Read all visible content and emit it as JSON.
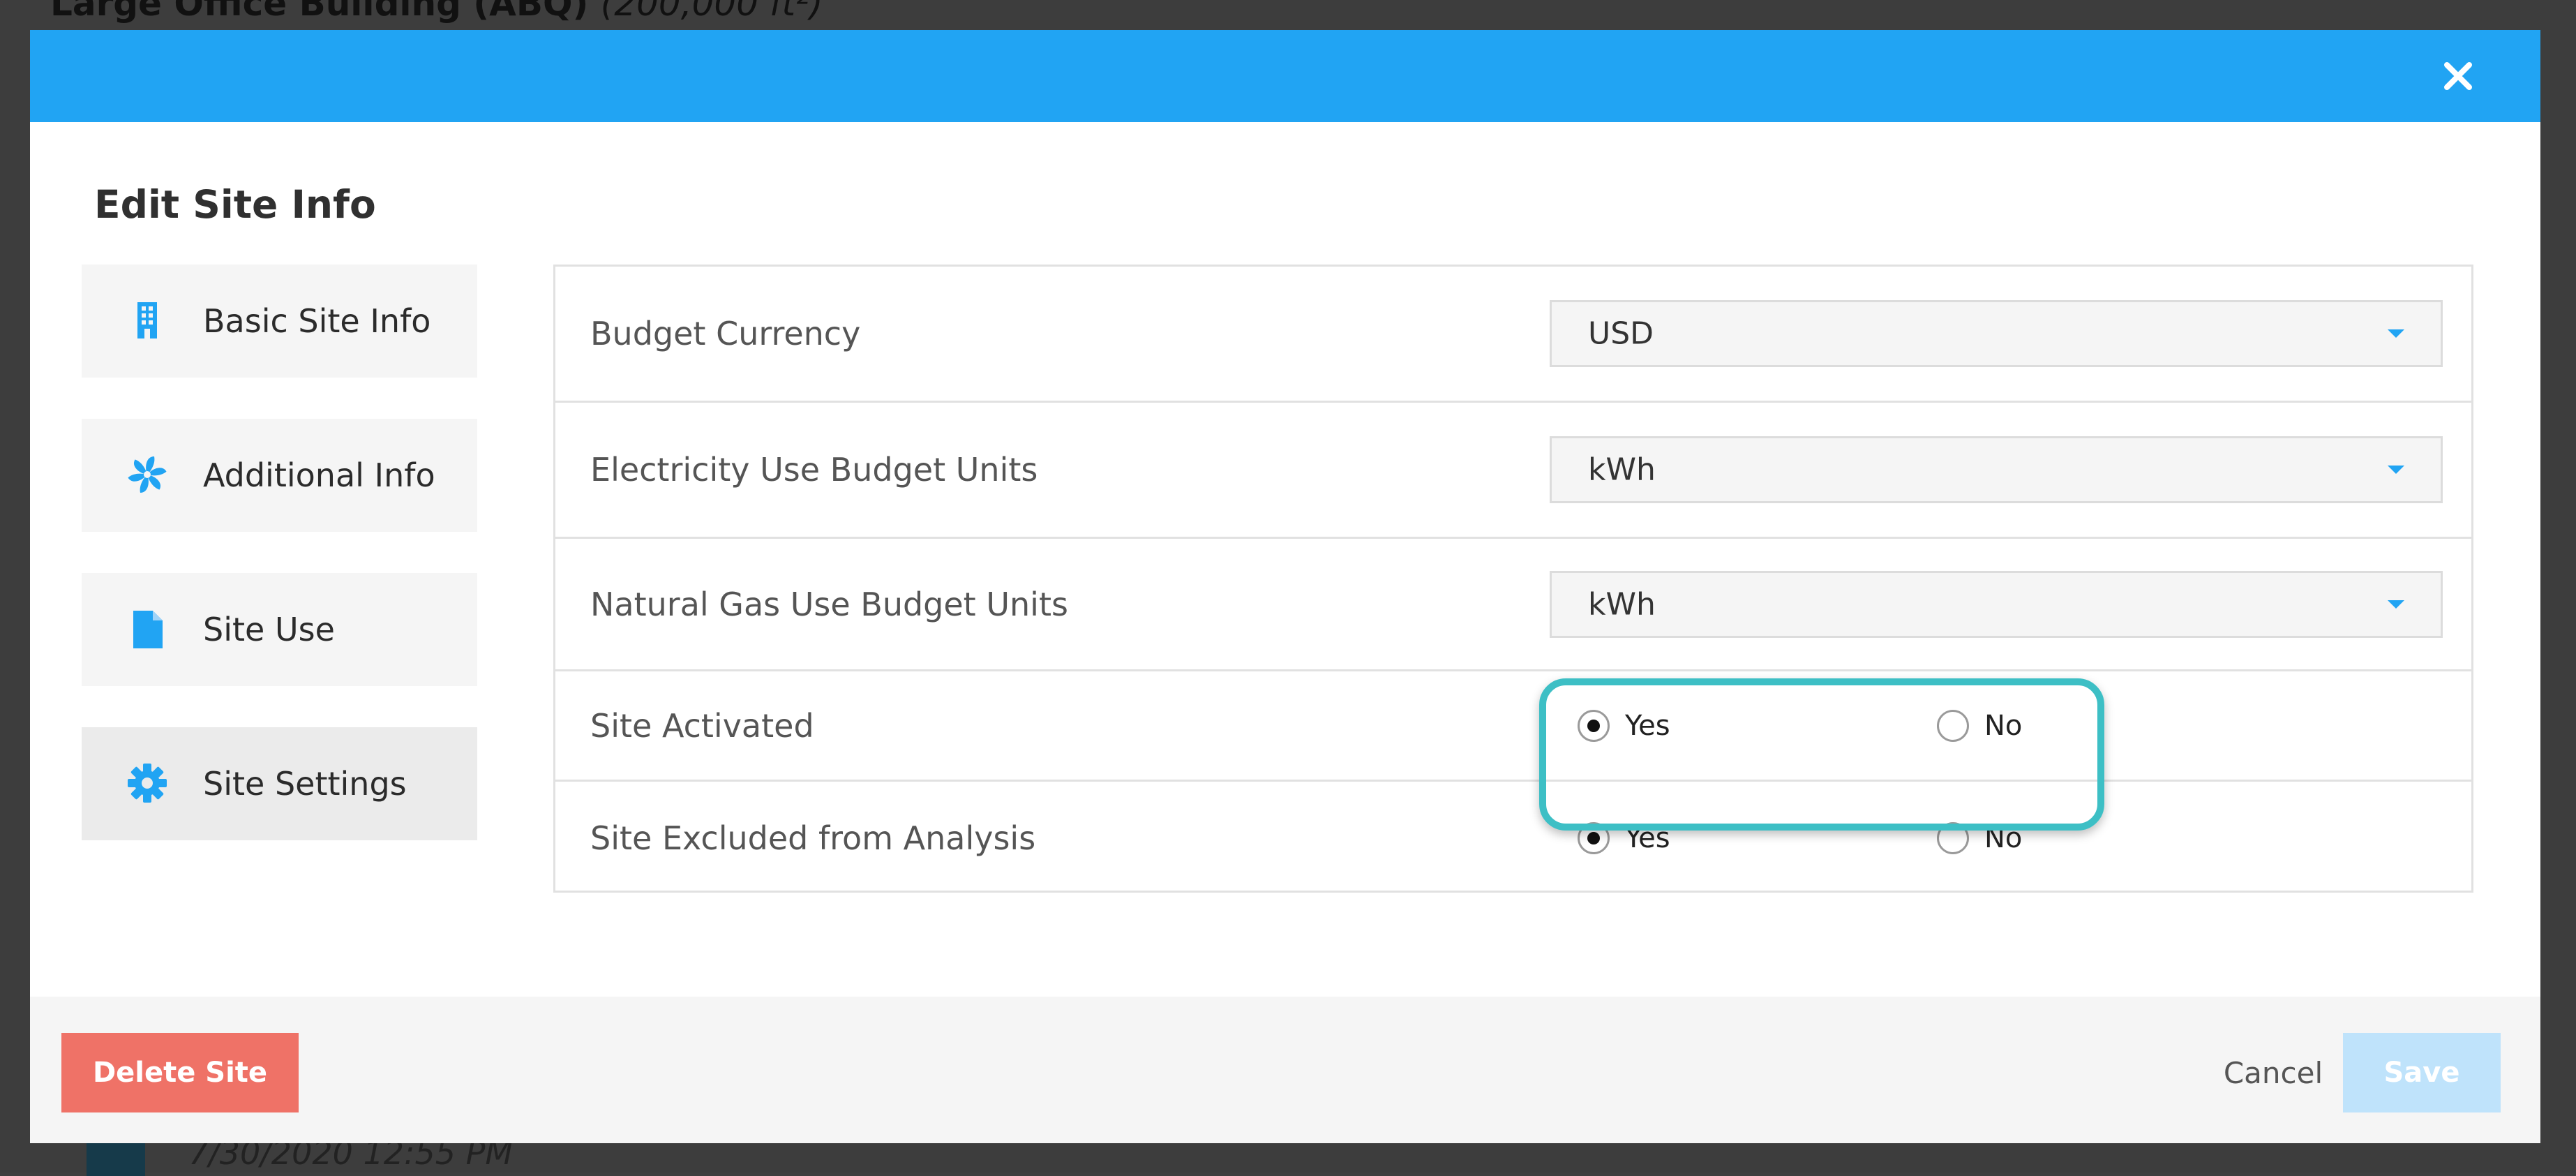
{
  "background": {
    "title": "Large Office Building (ABQ)",
    "title_area": "(200,000 ft²)",
    "date": "7/30/2020 12:55 PM"
  },
  "modal": {
    "title": "Edit Site Info",
    "close_icon": "close-icon",
    "header_color": "#21a4f3"
  },
  "nav": {
    "items": [
      {
        "label": "Basic Site Info",
        "icon": "building-icon"
      },
      {
        "label": "Additional Info",
        "icon": "fan-icon"
      },
      {
        "label": "Site Use",
        "icon": "document-icon"
      },
      {
        "label": "Site Settings",
        "icon": "gear-icon"
      }
    ],
    "active": "Site Settings"
  },
  "settings": {
    "budget_currency": {
      "label": "Budget Currency",
      "value": "USD"
    },
    "electricity_units": {
      "label": "Electricity Use Budget Units",
      "value": "kWh"
    },
    "gas_units": {
      "label": "Natural Gas Use Budget Units",
      "value": "kWh"
    },
    "site_activated": {
      "label": "Site Activated",
      "yes": "Yes",
      "no": "No",
      "selected": "Yes"
    },
    "site_excluded": {
      "label": "Site Excluded from Analysis",
      "yes": "Yes",
      "no": "No",
      "selected": "Yes"
    }
  },
  "footer": {
    "delete_label": "Delete Site",
    "cancel_label": "Cancel",
    "save_label": "Save"
  },
  "colors": {
    "accent": "#21a4f3",
    "delete": "#ef7267",
    "save_disabled": "#bfe3fb",
    "highlight": "#3dbfc5"
  }
}
